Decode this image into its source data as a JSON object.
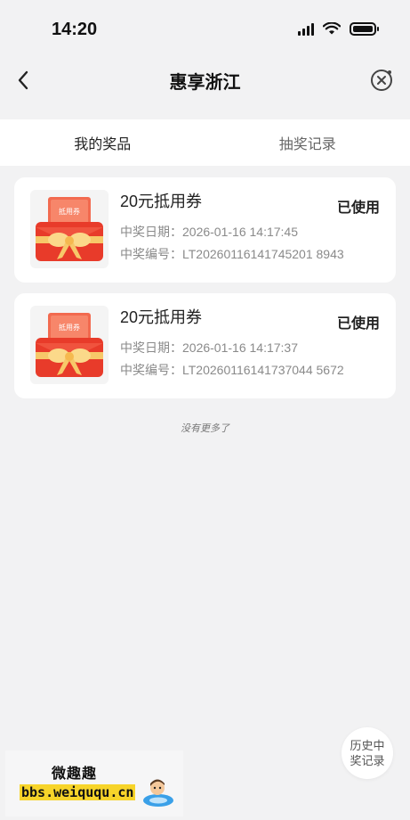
{
  "status_bar": {
    "time": "14:20"
  },
  "nav": {
    "title": "惠享浙江",
    "back_icon": "chevron-left-icon",
    "close_icon": "close-circle-icon"
  },
  "tabs": [
    {
      "label": "我的奖品",
      "active": true
    },
    {
      "label": "抽奖记录",
      "active": false
    }
  ],
  "prizes": [
    {
      "name": "20元抵用券",
      "status": "已使用",
      "date": "中奖日期：2026-01-16 14:17:45",
      "number": "中奖编号：LT20260116141745201 8943",
      "ticket_label": "抵用券"
    },
    {
      "name": "20元抵用券",
      "status": "已使用",
      "date": "中奖日期：2026-01-16 14:17:37",
      "number": "中奖编号：LT20260116141737044 5672",
      "ticket_label": "抵用券"
    }
  ],
  "list_end": "没有更多了",
  "history_button": {
    "line1": "历史中",
    "line2": "奖记录"
  },
  "watermark": {
    "top": "微趣趣",
    "bottom": "bbs.weiququ.cn"
  },
  "colors": {
    "accent_red": "#f04a3a",
    "ribbon": "#f7c869",
    "background": "#f2f2f3"
  }
}
